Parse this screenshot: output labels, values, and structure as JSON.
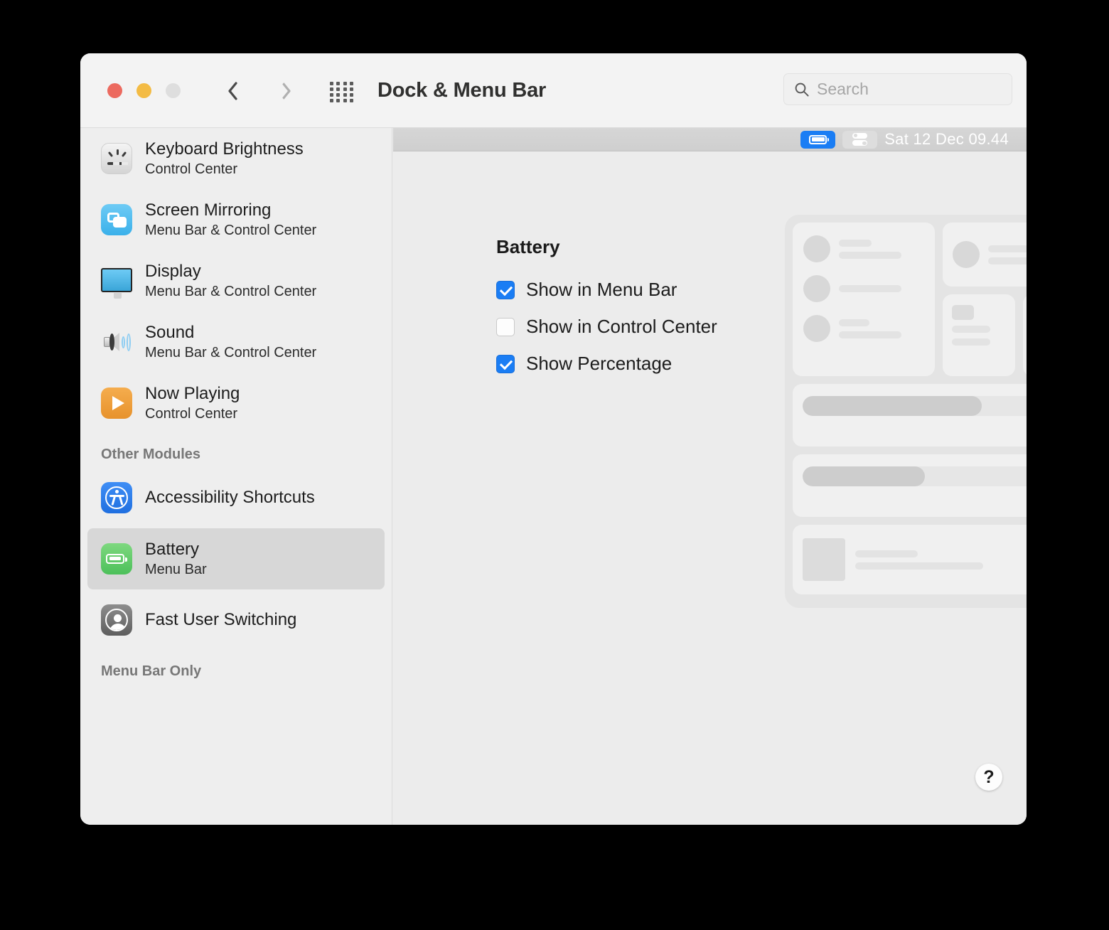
{
  "window": {
    "title": "Dock & Menu Bar",
    "traffic_lights": [
      "close",
      "minimize",
      "zoom"
    ],
    "nav": {
      "back": "back",
      "forward": "forward"
    },
    "grid_button": "show-all-preferences"
  },
  "search": {
    "placeholder": "Search",
    "value": ""
  },
  "sidebar": {
    "items": [
      {
        "title": "Keyboard Brightness",
        "subtitle": "Control Center",
        "icon": "keyboard-brightness-icon",
        "selected": false
      },
      {
        "title": "Screen Mirroring",
        "subtitle": "Menu Bar & Control Center",
        "icon": "screen-mirroring-icon",
        "selected": false
      },
      {
        "title": "Display",
        "subtitle": "Menu Bar & Control Center",
        "icon": "display-icon",
        "selected": false
      },
      {
        "title": "Sound",
        "subtitle": "Menu Bar & Control Center",
        "icon": "sound-icon",
        "selected": false
      },
      {
        "title": "Now Playing",
        "subtitle": "Control Center",
        "icon": "now-playing-icon",
        "selected": false
      }
    ],
    "section_other": "Other Modules",
    "other_items": [
      {
        "title": "Accessibility Shortcuts",
        "subtitle": "",
        "icon": "accessibility-icon",
        "selected": false
      },
      {
        "title": "Battery",
        "subtitle": "Menu Bar",
        "icon": "battery-icon",
        "selected": true
      },
      {
        "title": "Fast User Switching",
        "subtitle": "",
        "icon": "fast-user-switching-icon",
        "selected": false
      }
    ],
    "section_menu_bar_only": "Menu Bar Only"
  },
  "menu_bar_preview": {
    "battery_item": "battery-menu-icon",
    "control_center_item": "control-center-menu-icon",
    "clock": "Sat 12 Dec  09.44",
    "highlight_color": "#1a7df4"
  },
  "panel": {
    "title": "Battery",
    "checkboxes": [
      {
        "label": "Show in Menu Bar",
        "checked": true
      },
      {
        "label": "Show in Control Center",
        "checked": false
      },
      {
        "label": "Show Percentage",
        "checked": true
      }
    ]
  },
  "preview": {
    "name": "control-center-preview",
    "slider_fill_percent": [
      72,
      49
    ]
  },
  "help": {
    "label": "?"
  }
}
